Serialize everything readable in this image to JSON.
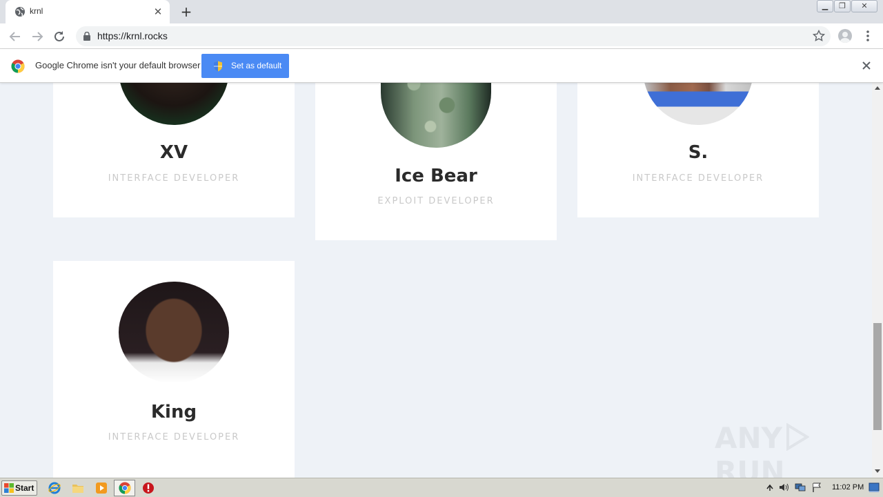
{
  "browser": {
    "tab_title": "krnl",
    "url": "https://krnl.rocks",
    "new_tab_symbol": "+",
    "tab_close_symbol": "✕"
  },
  "infobar": {
    "message": "Google Chrome isn't your default browser",
    "button_label": "Set as default"
  },
  "team": [
    {
      "name": "XV",
      "role": "INTERFACE DEVELOPER"
    },
    {
      "name": "Ice Bear",
      "role": "EXPLOIT DEVELOPER"
    },
    {
      "name": "S.",
      "role": "INTERFACE DEVELOPER"
    },
    {
      "name": "King",
      "role": "INTERFACE DEVELOPER"
    }
  ],
  "watermark": {
    "text_left": "ANY",
    "text_right": "RUN"
  },
  "taskbar": {
    "start_label": "Start",
    "clock": "11:02 PM"
  },
  "colors": {
    "accent_button": "#4a8af4",
    "page_background": "#eef2f7",
    "name_text": "#2b2b2b",
    "role_text": "#c9c9c9"
  }
}
